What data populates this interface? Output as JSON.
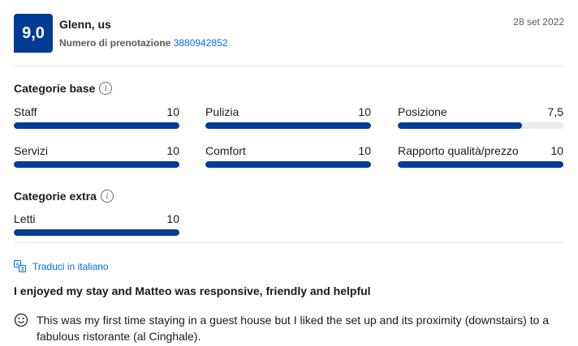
{
  "review": {
    "score": "9,0",
    "reviewer": "Glenn, us",
    "booking_label": "Numero di prenotazione",
    "booking_number": "3880942852",
    "date": "28 set 2022"
  },
  "categories_base": {
    "title": "Categorie base",
    "items": [
      {
        "label": "Staff",
        "value": "10",
        "fraction": 1.0
      },
      {
        "label": "Pulizia",
        "value": "10",
        "fraction": 1.0
      },
      {
        "label": "Posizione",
        "value": "7,5",
        "fraction": 0.75
      },
      {
        "label": "Servizi",
        "value": "10",
        "fraction": 1.0
      },
      {
        "label": "Comfort",
        "value": "10",
        "fraction": 1.0
      },
      {
        "label": "Rapporto qualità/prezzo",
        "value": "10",
        "fraction": 1.0
      }
    ]
  },
  "categories_extra": {
    "title": "Categorie extra",
    "items": [
      {
        "label": "Letti",
        "value": "10",
        "fraction": 1.0
      }
    ]
  },
  "translate_label": "Traduci in italiano",
  "review_title": "I enjoyed my stay and Matteo was responsive, friendly and helpful",
  "review_positive": "This was my first time staying in a guest house but I liked the set up and its proximity (downstairs) to a fabulous ristorante (al Cinghale).",
  "colors": {
    "accent": "#003b95",
    "link": "#006ce4",
    "track": "#ebebeb"
  },
  "icons": {
    "info": "info-icon",
    "translate": "translate-icon",
    "positive": "smiley-icon"
  }
}
